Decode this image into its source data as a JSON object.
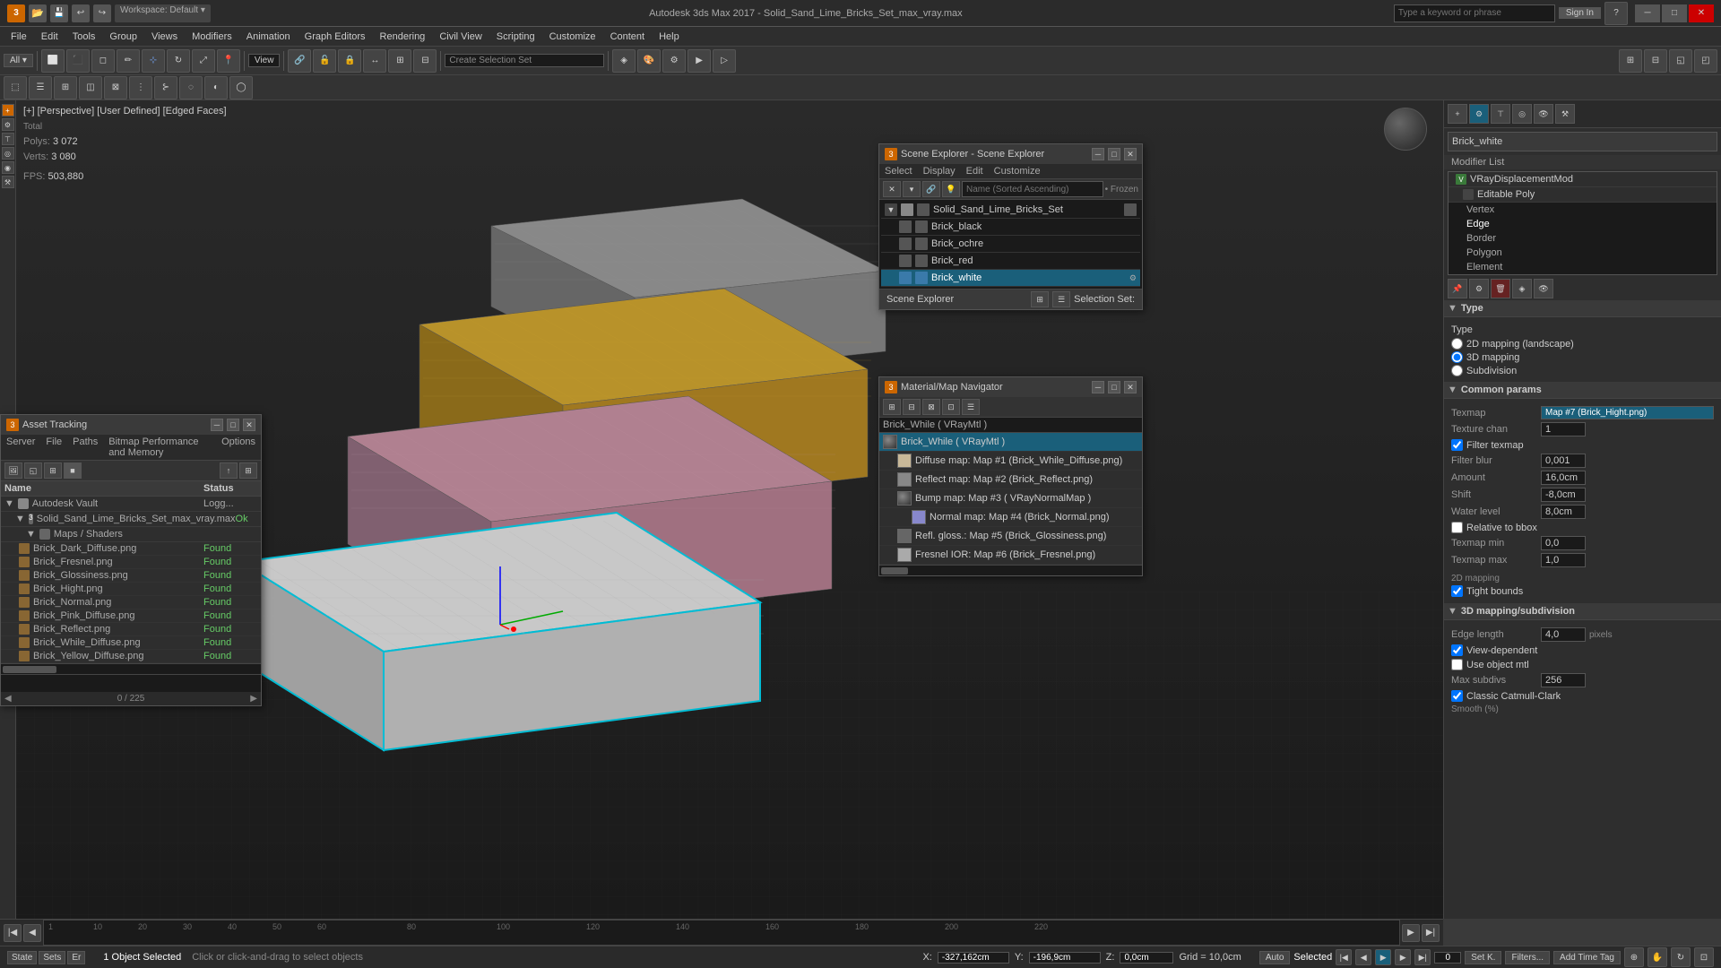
{
  "titlebar": {
    "title": "Autodesk 3ds Max 2017 - Solid_Sand_Lime_Bricks_Set_max_vray.max",
    "search_placeholder": "Type a keyword or phrase",
    "sign_in": "Sign In",
    "app_label": "3"
  },
  "menubar": {
    "items": [
      "File",
      "Edit",
      "Tools",
      "Group",
      "Views",
      "Modifiers",
      "Animation",
      "Graph Editors",
      "Rendering",
      "Civil View",
      "Scripting",
      "Customize",
      "Content",
      "Help"
    ]
  },
  "toolbar": {
    "create_selection": "Create Selection Set",
    "view_label": "View"
  },
  "viewport": {
    "info_line1": "[+] [Perspective] [User Defined] [Edged Faces]",
    "info_total": "Total",
    "polys_label": "Polys:",
    "polys_value": "3 072",
    "verts_label": "Verts:",
    "verts_value": "3 080",
    "fps_label": "FPS:",
    "fps_value": "503,880"
  },
  "asset_panel": {
    "title": "Asset Tracking",
    "menu": [
      "Server",
      "File",
      "Paths",
      "Bitmap Performance and Memory",
      "Options"
    ],
    "columns": [
      "Name",
      "Status"
    ],
    "groups": [
      {
        "name": "Autodesk Vault",
        "status": "Logg...",
        "expanded": true
      },
      {
        "name": "Solid_Sand_Lime_Bricks_Set_max_vray.max",
        "status": "Ok",
        "expanded": true
      },
      {
        "name": "Maps / Shaders",
        "status": "",
        "expanded": true
      }
    ],
    "items": [
      {
        "name": "Brick_Dark_Diffuse.png",
        "status": "Found"
      },
      {
        "name": "Brick_Fresnel.png",
        "status": "Found"
      },
      {
        "name": "Brick_Glossiness.png",
        "status": "Found"
      },
      {
        "name": "Brick_Hight.png",
        "status": "Found"
      },
      {
        "name": "Brick_Normal.png",
        "status": "Found"
      },
      {
        "name": "Brick_Pink_Diffuse.png",
        "status": "Found"
      },
      {
        "name": "Brick_Reflect.png",
        "status": "Found"
      },
      {
        "name": "Brick_While_Diffuse.png",
        "status": "Found"
      },
      {
        "name": "Brick_Yellow_Diffuse.png",
        "status": "Found"
      }
    ],
    "nav": "0 / 225"
  },
  "scene_panel": {
    "title": "Scene Explorer - Scene Explorer",
    "menu": [
      "Select",
      "Display",
      "Edit",
      "Customize"
    ],
    "search_placeholder": "Name (Sorted Ascending)",
    "frozen_label": "Frozen",
    "root": "Solid_Sand_Lime_Bricks_Set",
    "objects": [
      {
        "name": "Brick_black",
        "selected": false
      },
      {
        "name": "Brick_ochre",
        "selected": false
      },
      {
        "name": "Brick_red",
        "selected": false
      },
      {
        "name": "Brick_white",
        "selected": true
      }
    ],
    "footer_left": "Scene Explorer",
    "footer_right": "Selection Set:"
  },
  "material_panel": {
    "title": "Material/Map Navigator",
    "name_value": "Brick_While ( VRayMtl )",
    "items": [
      {
        "name": "Brick_While ( VRayMtl )",
        "type": "root",
        "selected": true
      },
      {
        "name": "Diffuse map: Map #1 (Brick_While_Diffuse.png)",
        "type": "diffuse"
      },
      {
        "name": "Reflect map: Map #2 (Brick_Reflect.png)",
        "type": "reflect"
      },
      {
        "name": "Bump map: Map #3 ( VRayNormalMap )",
        "type": "bump"
      },
      {
        "name": "Normal map: Map #4 (Brick_Normal.png)",
        "type": "normal"
      },
      {
        "name": "Refl. gloss.: Map #5 (Brick_Glossiness.png)",
        "type": "gloss"
      },
      {
        "name": "Fresnel IOR: Map #6 (Brick_Fresnel.png)",
        "type": "fresnel"
      }
    ]
  },
  "modifier_panel": {
    "object_name": "Brick_white",
    "modifier_list_label": "Modifier List",
    "modifiers": [
      {
        "name": "VRayDisplacementMod",
        "active": true
      },
      {
        "name": "Editable Poly",
        "active": false
      }
    ],
    "sub_items": [
      "Vertex",
      "Edge",
      "Border",
      "Polygon",
      "Element"
    ],
    "params": {
      "type_label": "Type",
      "type_2d": "2D mapping (landscape)",
      "type_3d": "3D mapping",
      "type_subdiv": "Subdivision",
      "common_params": "Common params",
      "texmap_label": "Texmap",
      "texmap_value": "Map #7 (Brick_Hight.png)",
      "texture_chan_label": "Texture chan",
      "texture_chan_value": "1",
      "filter_texmap": "Filter texmap",
      "filter_blur_label": "Filter blur",
      "filter_blur_value": "0,001",
      "amount_label": "Amount",
      "amount_value": "16,0cm",
      "shift_label": "Shift",
      "shift_value": "-8,0cm",
      "water_level_label": "Water level",
      "water_level_value": "8,0cm",
      "relative_to_bbox": "Relative to bbox",
      "texmap_min_label": "Texmap min",
      "texmap_min_value": "0,0",
      "texmap_max_label": "Texmap max",
      "texmap_max_value": "1,0",
      "mapping_2d_label": "2D mapping",
      "tight_bounds": "Tight bounds",
      "section_3d": "3D mapping/subdivision",
      "edge_length_label": "Edge length",
      "edge_length_value": "4,0",
      "pixels_label": "pixels",
      "view_dependent": "View-dependent",
      "use_object_mtl": "Use object mtl",
      "max_subdivs_label": "Max subdivs",
      "max_subdivs_value": "256",
      "classic_label": "Classic Catmull-Clark",
      "smooth_label": "Smooth (%)"
    }
  },
  "statusbar": {
    "object_selected": "1 Object Selected",
    "hint": "Click or click-and-drag to select objects",
    "x_label": "X:",
    "x_value": "-327,162cm",
    "y_label": "Y:",
    "y_value": "-196,9cm",
    "z_label": "Z:",
    "z_value": "0,0cm",
    "grid_label": "Grid = 10,0cm",
    "mode": "Auto",
    "selected_label": "Selected",
    "set_k": "Set K.",
    "filters": "Filters...",
    "add_time_tag": "Add Time Tag",
    "nav_value": "0 / 225"
  },
  "colors": {
    "accent_blue": "#1a5f7a",
    "selected_teal": "#00bcd4",
    "found_green": "#66cc66",
    "viewport_bg": "#1a1a1a",
    "panel_bg": "#2e2e2e",
    "toolbar_bg": "#333333"
  }
}
